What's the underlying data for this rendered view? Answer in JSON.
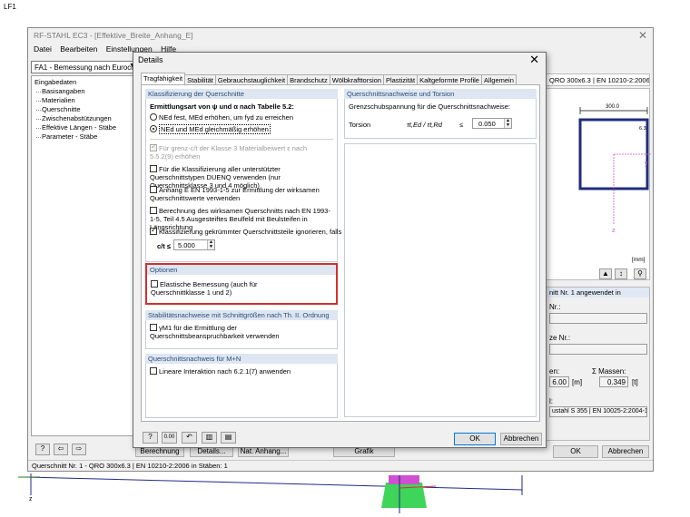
{
  "corner_label": "LF1",
  "main_window": {
    "title": "RF-STAHL EC3 - [Effektive_Breite_Anhang_E]",
    "menu": [
      "Datei",
      "Bearbeiten",
      "Einstellungen",
      "Hilfe"
    ],
    "case_combo": "FA1 - Bemessung nach Eurocod",
    "nav": {
      "root": "Eingabedaten",
      "items": [
        "Basisangaben",
        "Materialien",
        "Querschnitte",
        "Zwischenabstützungen",
        "Effektive Längen - Stäbe",
        "Parameter - Stäbe"
      ]
    },
    "section_header": "QRO 300x6.3 | EN 10210-2:2006",
    "dimension_width": "300.0",
    "dimension_thickness": "6.3",
    "axis_y": "y",
    "axis_z": "z",
    "unit_label": "[mm]",
    "props_title": "nitt Nr. 1 angewendet in",
    "label_nr1": "Nr.:",
    "label_nr2": "ze Nr.:",
    "label_en": "en:",
    "label_mass": "Σ Massen:",
    "value_6": "6.00",
    "unit_m": "[m]",
    "value_mass": "0.349",
    "unit_t": "[t]",
    "label_l": "l:",
    "material_value": "ustahl S 355 | EN 10025-2:2004-1:",
    "bottom_buttons": [
      "Berechnung",
      "Details...",
      "Nat. Anhang...",
      "Grafik"
    ],
    "ok": "OK",
    "cancel": "Abbrechen",
    "status": "Querschnitt Nr. 1 - QRO 300x6.3 | EN 10210-2:2006 in Stäben: 1"
  },
  "dialog": {
    "title": "Details",
    "tabs": [
      "Tragfähigkeit",
      "Stabilität",
      "Gebrauchstauglichkeit",
      "Brandschutz",
      "Wölbkrafttorsion",
      "Plastizität",
      "Kaltgeformte Profile",
      "Allgemein"
    ],
    "classification": {
      "header": "Klassifizierung der Querschnitte",
      "method_label": "Ermittlungsart von ψ und α nach Tabelle 5.2:",
      "radio1": "NEd fest, MEd erhöhen, um fyd zu erreichen",
      "radio2": "NEd und MEd gleichmäßig erhöhen",
      "opt_grenz": "Für grenz-c/t der Klasse 3 Materialbeiwert ε nach 5.5.2(9) erhöhen",
      "opt_unsupported": "Für die Klassifizierung aller unterstützter Querschnittstypen DUENQ verwenden (nur Querschnittsklasse 3 und 4 möglich)",
      "opt_anhang": "Anhang E EN 1993-1-5 zur Ermittlung der wirksamen Querschnittswerte verwenden",
      "opt_calc": "Berechnung des wirksamen Querschnitts nach EN 1993-1-5, Teil 4.5 Ausgesteiftes Beulfeld mit Beulsteifen in Längsrichtung",
      "opt_curved": "Klassifizierung gekrümmter Querschnittsteile ignorieren, falls",
      "ct_label": "c/t ≤",
      "ct_value": "5.000"
    },
    "options": {
      "header": "Optionen",
      "elastic": "Elastische Bemessung (auch für Querschnittklasse 1 und 2)"
    },
    "stability": {
      "header": "Stabilitätsnachweise mit Schnittgrößen nach Th. II. Ordnung",
      "gamma": "γM1 für die Ermittlung der Querschnittsbeanspruchbarkeit verwenden"
    },
    "mn": {
      "header": "Querschnittsnachweis für M+N",
      "linear": "Lineare Interaktion nach 6.2.1(7) anwenden"
    },
    "shear": {
      "header": "Querschnittsnachweise und Torsion",
      "limit_label": "Grenzschubspannung für die Querschnittsnachweise:",
      "torsion": "Torsion",
      "formula": "τt,Ed / τt,Rd",
      "le": "≤",
      "value": "0.050"
    },
    "ok": "OK",
    "cancel": "Abbrechen"
  }
}
